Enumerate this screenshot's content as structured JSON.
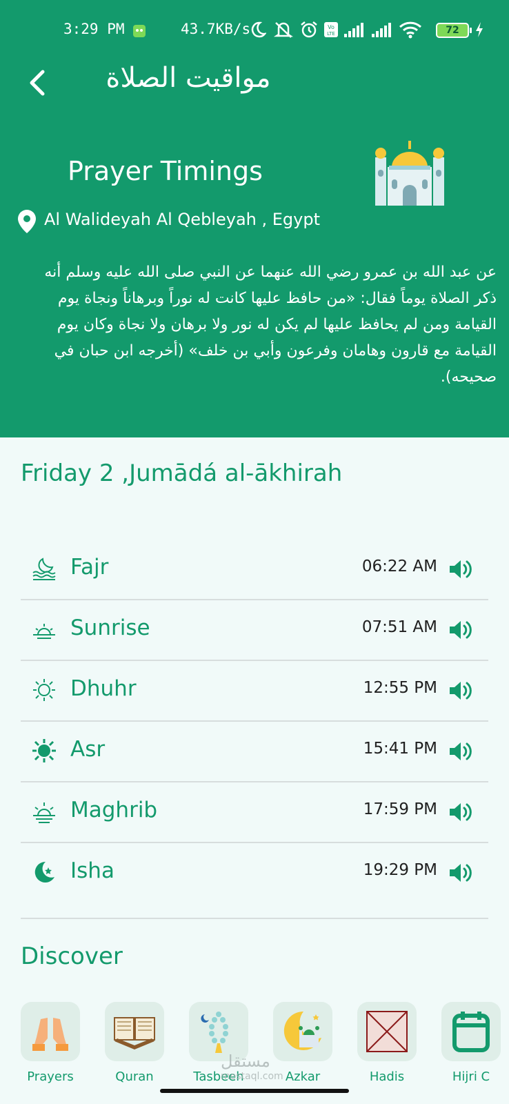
{
  "status_bar": {
    "time": "3:29 PM",
    "net_speed": "43.7KB/s",
    "battery": "72",
    "icons": [
      "moon-icon",
      "mute-icon",
      "alarm-icon",
      "volte-icon",
      "signal-icon",
      "signal-icon",
      "wifi-icon",
      "charging-icon"
    ]
  },
  "header": {
    "ar_title": "مواقيت الصلاة",
    "title": "Prayer Timings",
    "location": "Al Walideyah Al Qebleyah , Egypt",
    "hadith": "عن عبد الله بن عمرو رضي الله عنهما عن النبي صلى الله عليه وسلم أنه ذكر الصلاة يوماً فقال: «من حافظ عليها كانت له نوراً وبرهاناً ونجاة يوم القيامة ومن لم يحافظ عليها لم يكن له نور ولا برهان ولا نجاة وكان يوم القيامة مع قارون وهامان وفرعون وأبي بن خلف» (أخرجه ابن حبان في صحيحه).",
    "bg_color": "#139a6c"
  },
  "date": "Friday 2 ,Jumādá al-ākhirah",
  "prayers": [
    {
      "name": "Fajr",
      "time": "06:22 AM",
      "icon": "fajr-icon"
    },
    {
      "name": "Sunrise",
      "time": "07:51 AM",
      "icon": "sunrise-icon"
    },
    {
      "name": "Dhuhr",
      "time": "12:55 PM",
      "icon": "sun-outline-icon"
    },
    {
      "name": "Asr",
      "time": "15:41 PM",
      "icon": "sun-filled-icon"
    },
    {
      "name": "Maghrib",
      "time": "17:59 PM",
      "icon": "sunset-icon"
    },
    {
      "name": "Isha",
      "time": "19:29 PM",
      "icon": "crescent-star-icon"
    }
  ],
  "discover": {
    "title": "Discover",
    "items": [
      {
        "label": "Prayers",
        "icon": "praying-hands-icon"
      },
      {
        "label": "Quran",
        "icon": "quran-icon"
      },
      {
        "label": "Tasbeeh",
        "icon": "tasbeeh-icon"
      },
      {
        "label": "Azkar",
        "icon": "crescent-mosque-icon"
      },
      {
        "label": "Hadis",
        "icon": "broken-image-icon"
      },
      {
        "label": "Hijri C",
        "icon": "calendar-icon"
      }
    ]
  },
  "watermark": {
    "ar": "مستقل",
    "en": "mostaql.com"
  },
  "accent_color": "#139a6c"
}
